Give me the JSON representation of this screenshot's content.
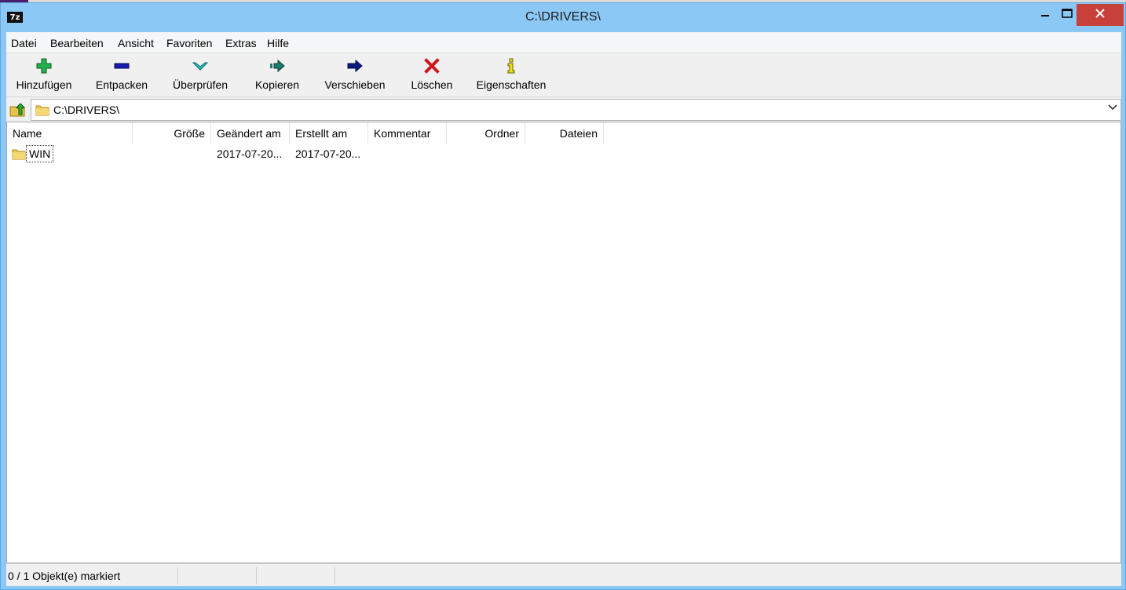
{
  "window": {
    "title": "C:\\DRIVERS\\",
    "app_icon_text": "7z",
    "minimize_icon": "minimize-icon",
    "maximize_icon": "maximize-icon",
    "close_icon": "close-icon"
  },
  "menu": [
    "Datei",
    "Bearbeiten",
    "Ansicht",
    "Favoriten",
    "Extras",
    "Hilfe"
  ],
  "toolbar": [
    {
      "label": "Hinzufügen",
      "icon": "add-plus-icon",
      "color": "#22b14c"
    },
    {
      "label": "Entpacken",
      "icon": "extract-minus-icon",
      "color": "#1a1ab0"
    },
    {
      "label": "Überprüfen",
      "icon": "test-check-icon",
      "color": "#27c0c0"
    },
    {
      "label": "Kopieren",
      "icon": "copy-arrow-icon",
      "color": "#1d7a6e"
    },
    {
      "label": "Verschieben",
      "icon": "move-arrow-icon",
      "color": "#0a1a80"
    },
    {
      "label": "Löschen",
      "icon": "delete-x-icon",
      "color": "#d0161b"
    },
    {
      "label": "Eigenschaften",
      "icon": "info-icon",
      "color": "#f2e21c"
    }
  ],
  "address": {
    "path": "C:\\DRIVERS\\"
  },
  "columns": [
    "Name",
    "Größe",
    "Geändert am",
    "Erstellt am",
    "Kommentar",
    "Ordner",
    "Dateien"
  ],
  "rows": [
    {
      "name": "WIN",
      "size": "",
      "modified": "2017-07-20...",
      "created": "2017-07-20...",
      "comment": "",
      "folders": "",
      "files": ""
    }
  ],
  "status": {
    "selection": "0 / 1 Objekt(e) markiert"
  }
}
